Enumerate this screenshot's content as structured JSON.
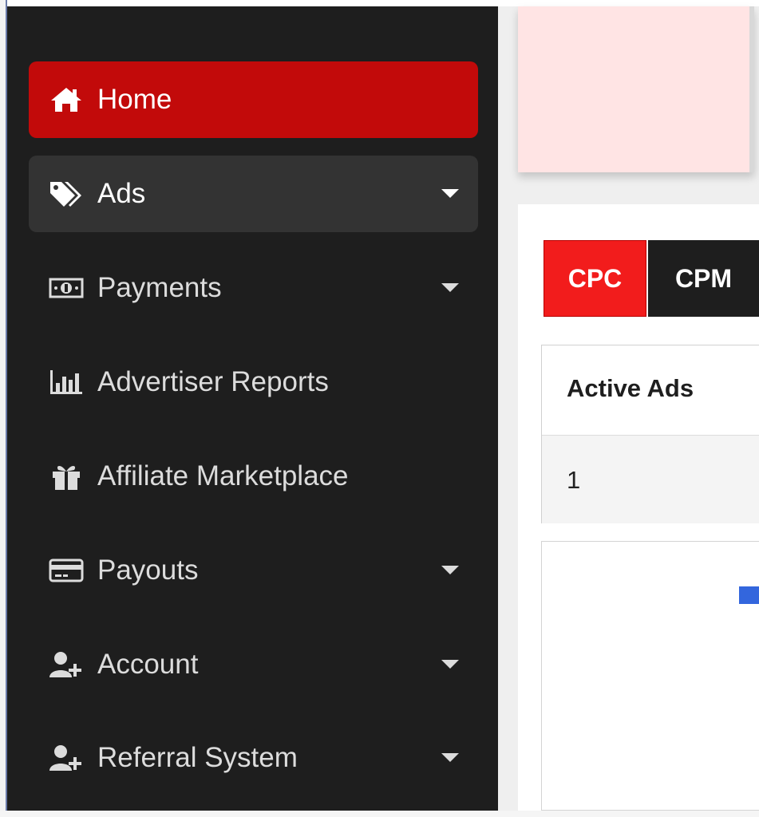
{
  "sidebar": {
    "items": [
      {
        "label": "Home",
        "icon": "home-icon",
        "state": "active",
        "has_caret": false
      },
      {
        "label": "Ads",
        "icon": "tags-icon",
        "state": "expanded",
        "has_caret": true
      },
      {
        "label": "Payments",
        "icon": "money-bill-icon",
        "state": "normal",
        "has_caret": true
      },
      {
        "label": "Advertiser Reports",
        "icon": "bar-chart-icon",
        "state": "normal",
        "has_caret": false
      },
      {
        "label": "Affiliate Marketplace",
        "icon": "gift-icon",
        "state": "normal",
        "has_caret": false
      },
      {
        "label": "Payouts",
        "icon": "credit-card-icon",
        "state": "normal",
        "has_caret": true
      },
      {
        "label": "Account",
        "icon": "user-plus-icon",
        "state": "normal",
        "has_caret": true
      },
      {
        "label": "Referral System",
        "icon": "user-plus-icon",
        "state": "normal",
        "has_caret": true
      }
    ]
  },
  "main": {
    "tabs": [
      {
        "label": "CPC",
        "active": true
      },
      {
        "label": "CPM",
        "active": false
      }
    ],
    "stats_table": {
      "columns": [
        "Active Ads"
      ],
      "rows": [
        [
          "1"
        ]
      ]
    }
  },
  "colors": {
    "sidebar_bg": "#1e1e1e",
    "active_red": "#c20a0a",
    "tab_red": "#f21c1c",
    "banner_pink": "#ffe4e4",
    "legend_blue": "#3366dd"
  }
}
